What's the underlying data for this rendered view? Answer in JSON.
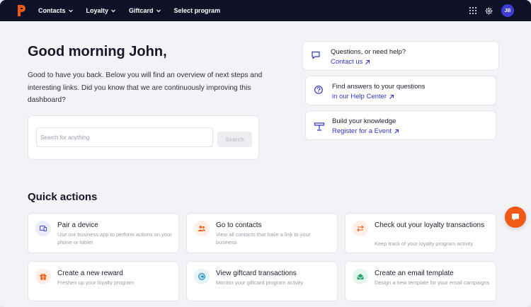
{
  "nav": {
    "items": [
      {
        "label": "Contacts",
        "dropdown": true
      },
      {
        "label": "Loyalty",
        "dropdown": true
      },
      {
        "label": "Giftcard",
        "dropdown": true
      },
      {
        "label": "Select program",
        "dropdown": false
      }
    ],
    "avatar_initials": "JB"
  },
  "hero": {
    "greeting": "Good morning John,",
    "intro": "Good to have you back. Below you will find an overview of next steps and interesting links. Did you know that we are continuously improving this dashboard?",
    "search_placeholder": "Search for anything",
    "search_button": "Search"
  },
  "help": [
    {
      "title": "Questions, or need help?",
      "link": "Contact us",
      "icon": "chat-bubble-icon"
    },
    {
      "title": "Find answers to your questions",
      "link": "in our Help Center",
      "icon": "question-circle-icon"
    },
    {
      "title": "Build your knowledge",
      "link": "Register for a Event",
      "icon": "lectern-icon"
    }
  ],
  "quick_actions": {
    "title": "Quick actions",
    "items": [
      {
        "label": "Pair a device",
        "desc": "Use our business app to perform actions on your phone or tablet",
        "icon": "devices-icon",
        "color": "#4a4fd8",
        "bg": "#ebecfb"
      },
      {
        "label": "Go to contacts",
        "desc": "View all contacts that have a link to your business",
        "icon": "users-icon",
        "color": "#f05a14",
        "bg": "#fdeee6"
      },
      {
        "label": "Check out your loyalty transactions",
        "desc": "Keep track of your loyalty program activity",
        "icon": "swap-arrows-icon",
        "color": "#f05a14",
        "bg": "#fdeee6"
      },
      {
        "label": "Create a new reward",
        "desc": "Freshen up your loyalty program",
        "icon": "gift-icon",
        "color": "#f05a14",
        "bg": "#fdeee6"
      },
      {
        "label": "View giftcard transactions",
        "desc": "Monitor your giftcard program activity",
        "icon": "coin-icon",
        "color": "#1f8fb8",
        "bg": "#e4f4fa"
      },
      {
        "label": "Create an email template",
        "desc": "Design a new template for your email campaigns",
        "icon": "envelope-open-icon",
        "color": "#1fa46a",
        "bg": "#e3f6ec"
      }
    ]
  },
  "colors": {
    "accent": "#f05a14",
    "link": "#3034c9",
    "nav_bg": "#0f1126"
  }
}
